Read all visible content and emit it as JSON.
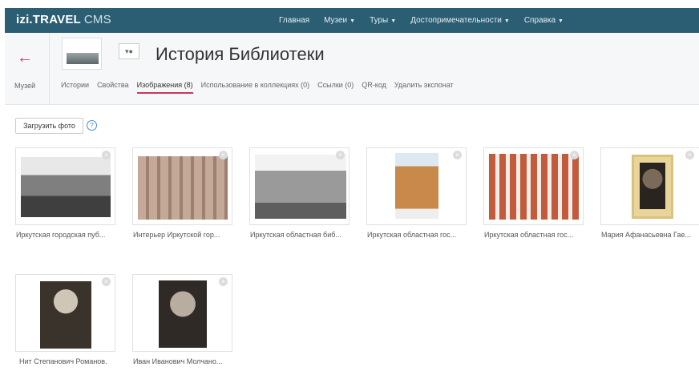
{
  "brand": {
    "name": "izi.TRAVEL",
    "product": "CMS"
  },
  "topnav": [
    {
      "label": "Главная",
      "dropdown": false
    },
    {
      "label": "Музеи",
      "dropdown": true
    },
    {
      "label": "Туры",
      "dropdown": true
    },
    {
      "label": "Достопримечательности",
      "dropdown": true
    },
    {
      "label": "Справка",
      "dropdown": true
    }
  ],
  "header": {
    "back_label": "Музей",
    "title": "История Библиотеки",
    "tabs": [
      {
        "label": "Истории",
        "active": false
      },
      {
        "label": "Свойства",
        "active": false
      },
      {
        "label": "Изображения (8)",
        "active": true
      },
      {
        "label": "Использование в коллекциях (0)",
        "active": false
      },
      {
        "label": "Ссылки (0)",
        "active": false
      },
      {
        "label": "QR-код",
        "active": false
      },
      {
        "label": "Удалить экспонат",
        "active": false
      }
    ]
  },
  "toolbar": {
    "upload_label": "Загрузить фото",
    "help_icon": "question-circle-icon"
  },
  "images": [
    {
      "caption": "Иркутская городская пуб..."
    },
    {
      "caption": "Интерьер Иркутской гор..."
    },
    {
      "caption": "Иркутская областная биб..."
    },
    {
      "caption": "Иркутская областная гос..."
    },
    {
      "caption": "Иркутская областная гос..."
    },
    {
      "caption": "Мария Афанасьевна Гае..."
    },
    {
      "caption": "Нит Степанович Романов."
    },
    {
      "caption": "Иван Иванович Молчано..."
    }
  ],
  "colors": {
    "topbar": "#2c5e73",
    "accent": "#c8385a",
    "help": "#4a8bc4"
  }
}
